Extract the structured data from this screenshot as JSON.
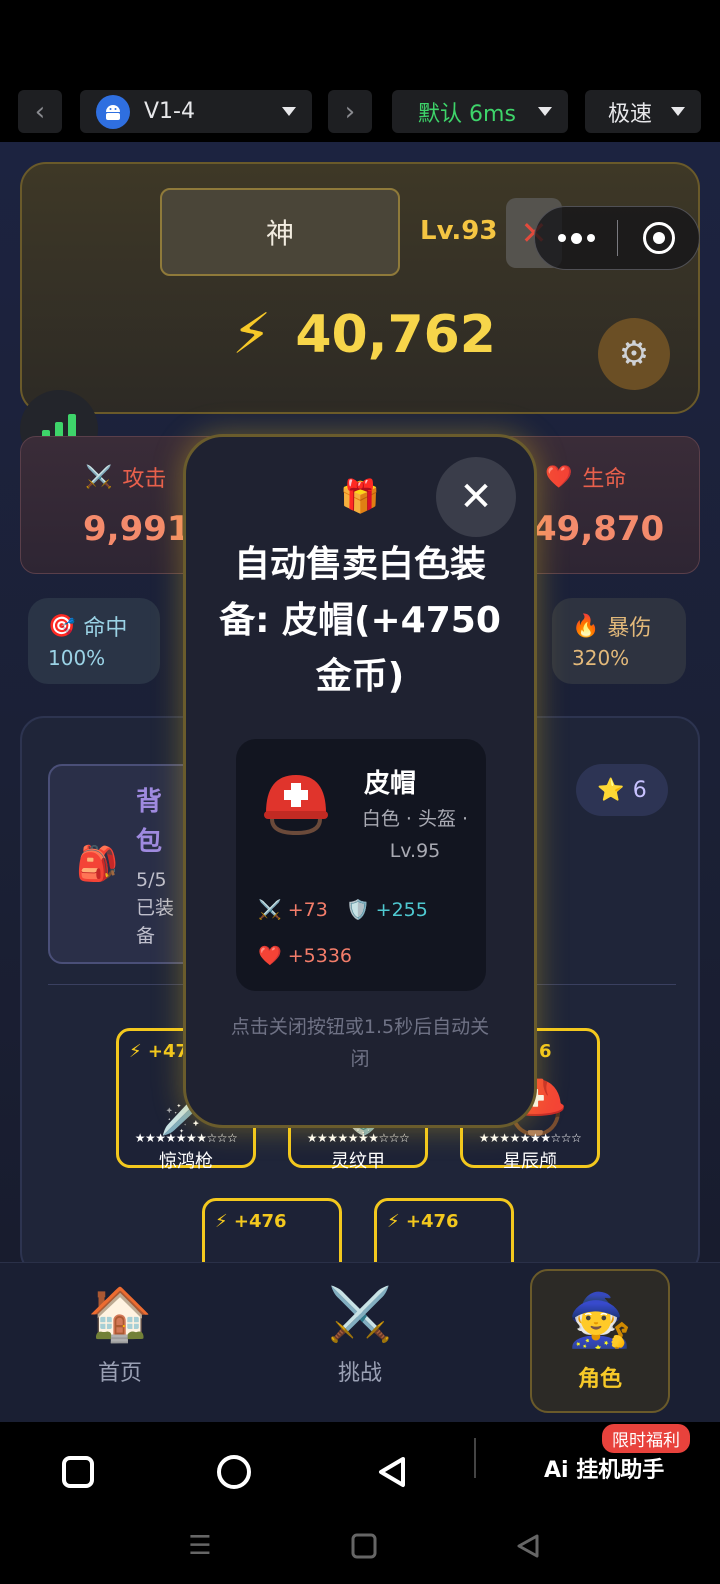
{
  "topbar": {
    "device_label": "V1-4",
    "network_label": "默认 6ms",
    "speed_label": "极速"
  },
  "hero": {
    "title": "神",
    "level": "Lv.93",
    "power": "40,762"
  },
  "stats": {
    "attack_label": "攻击",
    "attack_value": "9,991",
    "hp_label": "生命",
    "hp_value": "49,870",
    "hit_label": "命中",
    "hit_value": "100%",
    "critdmg_label": "暴伤",
    "critdmg_value": "320%"
  },
  "inventory": {
    "bag_title": "背包",
    "bag_count": "5/5 已装备",
    "stars": "6",
    "equip_power_1": "+47",
    "equip_power_3": "6",
    "equip_power_4": "+476",
    "equip_power_5": "+476",
    "equip_stars": "★★★★★★★☆☆☆",
    "equip_name_1": "惊鸿枪",
    "equip_name_2": "灵纹甲",
    "equip_name_3": "星辰颅"
  },
  "modal": {
    "title": "自动售卖白色装备: 皮帽(+4750金币)",
    "item_name": "皮帽",
    "item_meta": "白色 · 头盔 · Lv.95",
    "stat_atk": "+73",
    "stat_def": "+255",
    "stat_hp": "+5336",
    "hint": "点击关闭按钮或1.5秒后自动关闭"
  },
  "bottom_nav": {
    "home": "首页",
    "challenge": "挑战",
    "character": "角色"
  },
  "system": {
    "app_logo": "Ai 挂机助手",
    "promo": "限时福利"
  },
  "colors": {
    "accent_gold": "#f7c928",
    "network_green": "#3ed46a",
    "promo_red": "#e8423c"
  }
}
